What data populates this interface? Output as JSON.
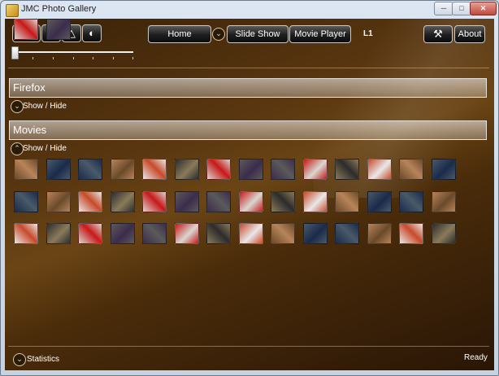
{
  "window": {
    "title": "JMC Photo Gallery",
    "caption_buttons": {
      "minimize": "─",
      "maximize": "□",
      "close": "✕"
    }
  },
  "toolbar": {
    "back_icon": "⇦",
    "forward_icon": "⇨",
    "up_icon": "△",
    "rotate_icon": "◐",
    "home_label": "Home",
    "dropdown_icon": "⌄",
    "slideshow_label": "Slide Show",
    "movieplayer_label": "Movie Player",
    "level_label": "L1",
    "tools_icon": "⚒",
    "about_label": "About"
  },
  "slider": {
    "value_fraction": 0.0
  },
  "sections": [
    {
      "title": "Firefox",
      "toggle_label": "Show / Hide",
      "toggle_icon": "⌄",
      "collapsed": true
    },
    {
      "title": "Movies",
      "toggle_label": "Show / Hide",
      "toggle_icon": "⌃",
      "collapsed": false
    }
  ],
  "thumbnails_count": 44,
  "footer": {
    "stats_label": "Statistics",
    "stats_icon": "⌄",
    "status": "Ready"
  },
  "colors": {
    "background_brown": "#5a3710",
    "thumbnail_palette": [
      "#6a4a2a",
      "#2c2c2c",
      "#8a7a5a",
      "#b8845a",
      "#3c2c4c",
      "#4a5a6a",
      "#d8d8d0",
      "#c84a2a",
      "#e8e8e8",
      "#c81818",
      "#1a2a4a",
      "#5a5a5a"
    ]
  }
}
